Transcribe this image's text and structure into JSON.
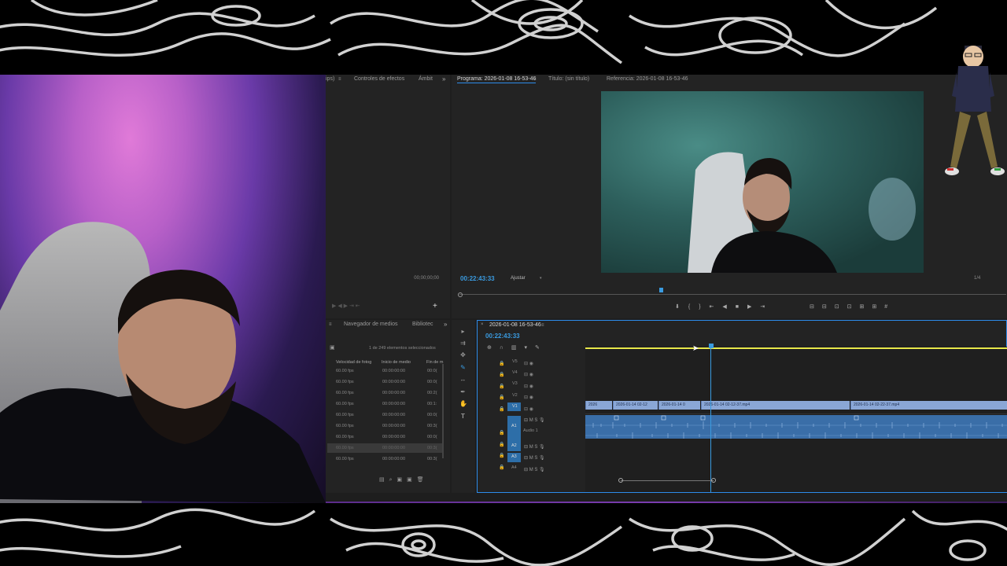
{
  "source_panel": {
    "tabs": [
      "ips)",
      "Controles de efectos",
      "Ámbit"
    ],
    "timecode": "00;00;00;00"
  },
  "program_panel": {
    "tabs": [
      "Programa: 2026-01-08 16-53-46",
      "Título: (sin título)",
      "Referencia: 2026-01-08 16-53-46"
    ],
    "timecode": "00:22:43:33",
    "fit_label": "Ajustar",
    "fraction": "1/4"
  },
  "project_panel": {
    "tabs": [
      "Navegador de medios",
      "Bibliotec"
    ],
    "selection_info": "1 de 249 elementos seleccionados",
    "columns": [
      "Velocidad de fotog",
      "Inicio de medio",
      "Fin de m"
    ],
    "rows": [
      {
        "fps": "60.00 fps",
        "start": "00:00:00:00",
        "end": "00:0("
      },
      {
        "fps": "60.00 fps",
        "start": "00:00:00:00",
        "end": "00:0("
      },
      {
        "fps": "60.00 fps",
        "start": "00:00:00:00",
        "end": "00:2("
      },
      {
        "fps": "60.00 fps",
        "start": "00:00:00:00",
        "end": "00:1:"
      },
      {
        "fps": "60.00 fps",
        "start": "00:00:00:00",
        "end": "00:0("
      },
      {
        "fps": "60.00 fps",
        "start": "00:00:00:00",
        "end": "00:3("
      },
      {
        "fps": "60.00 fps",
        "start": "00:00:00:00",
        "end": "00:0("
      },
      {
        "fps": "60.00 fps",
        "start": "00:00:00:00",
        "end": "00:3("
      },
      {
        "fps": "60.00 fps",
        "start": "00:00:00:00",
        "end": "00:3("
      }
    ]
  },
  "timeline": {
    "sequence_tab": "2026-01-08 16-53-46",
    "timecode": "00:22:43:33",
    "video_tracks": [
      "V5",
      "V4",
      "V3",
      "V2",
      "V1"
    ],
    "audio_tracks": [
      "A1",
      "A2",
      "A3",
      "A4"
    ],
    "audio_track_name": "Audio 1",
    "clips": [
      "2026",
      "2026-01-14 02-12",
      "2026-01-14 0",
      "2026-01-14 02-12-37.mp4",
      "2026-01-14 02-22-37.mp4"
    ]
  },
  "colors": {
    "accent_blue": "#2d8ceb",
    "playhead": "#3a9be0",
    "work_area": "#e8e84a",
    "video_clip": "#8aa7d6",
    "audio_clip": "#3a6ea8"
  }
}
